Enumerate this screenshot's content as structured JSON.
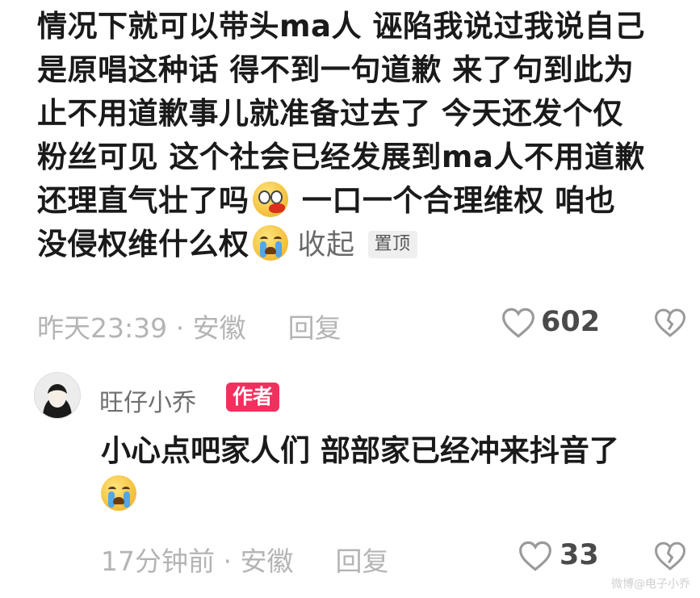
{
  "comment": {
    "lines": [
      "情况下就可以带头ma人 诬陷我说过我说自己",
      "是原唱这种话 得不到一句道歉 来了句到此为",
      "止不用道歉事儿就准备过去了 今天还发个仅",
      "粉丝可见 这个社会已经发展到ma人不用道歉",
      "还理直气壮了吗",
      "一口一个合理维权 咱也",
      "没侵权维什么权"
    ],
    "collapse_label": "收起",
    "pinned_label": "置顶",
    "time": "昨天23:39",
    "location": "安徽",
    "reply_label": "回复",
    "likes": "602"
  },
  "reply": {
    "username": "旺仔小乔",
    "author_badge": "作者",
    "text": "小心点吧家人们 部部家已经冲来抖音了",
    "time": "17分钟前",
    "location": "安徽",
    "reply_label": "回复",
    "likes": "33"
  },
  "meta_separator": " · ",
  "icons": {
    "emoji_1": "shocked-bleeding-emoji",
    "emoji_2": "crying-emoji",
    "like": "heart-outline-icon",
    "dislike": "broken-heart-icon"
  },
  "colors": {
    "badge": "#f2305e",
    "meta_text": "#b4b4b4"
  },
  "watermark": "微博@电子小乔"
}
